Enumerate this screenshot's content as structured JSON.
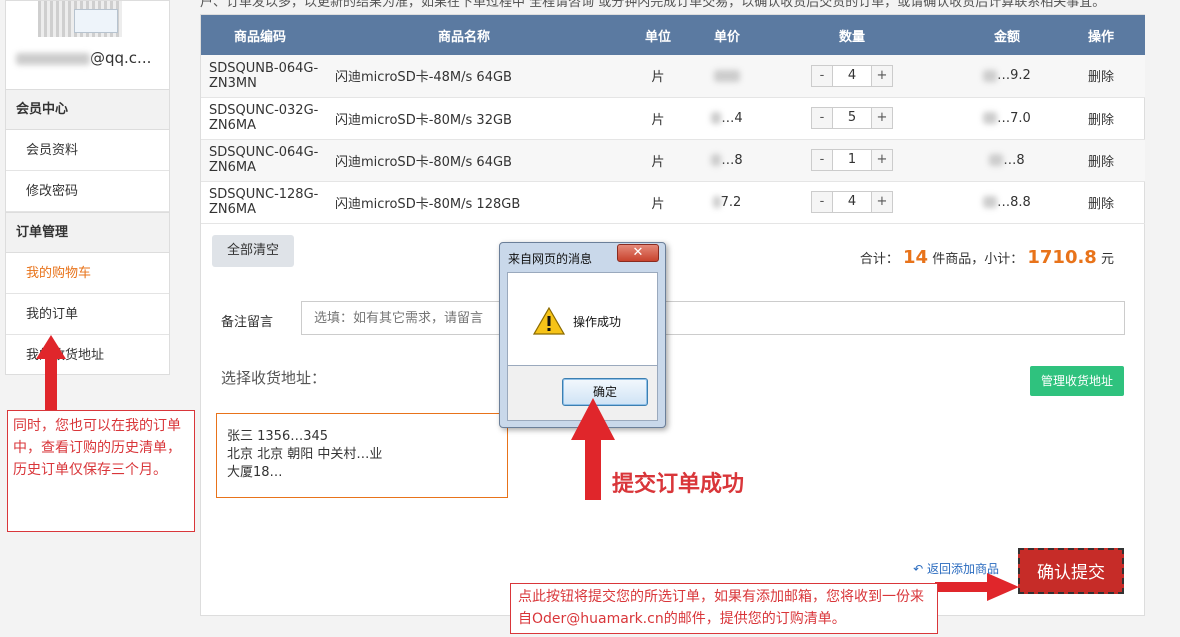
{
  "top_text": "户、订单发以多，以更新的结果为准，如果在下单过程中 全程请咨询 或分钟内完成订单交易，以确认收货后交货的订单，或请确认收货后计算联系相关事宜。",
  "sidebar": {
    "email_suffix": "@qq.c...",
    "section_member": "会员中心",
    "item_profile": "会员资料",
    "item_password": "修改密码",
    "section_orders": "订单管理",
    "item_cart": "我的购物车",
    "item_orders": "我的订单",
    "item_address": "我的收货地址"
  },
  "table": {
    "headers": [
      "商品编码",
      "商品名称",
      "单位",
      "单价",
      "数量",
      "金额",
      "操作"
    ],
    "rows": [
      {
        "code": "SDSQUNB-064G-ZN3MN",
        "name": "闪迪microSD卡-48M/s 64GB",
        "unit": "片",
        "price": "…",
        "qty": "4",
        "amount": "…9.2",
        "action": "删除"
      },
      {
        "code": "SDSQUNC-032G-ZN6MA",
        "name": "闪迪microSD卡-80M/s 32GB",
        "unit": "片",
        "price": "…4",
        "qty": "5",
        "amount": "…7.0",
        "action": "删除"
      },
      {
        "code": "SDSQUNC-064G-ZN6MA",
        "name": "闪迪microSD卡-80M/s 64GB",
        "unit": "片",
        "price": "…8",
        "qty": "1",
        "amount": "…8",
        "action": "删除"
      },
      {
        "code": "SDSQUNC-128G-ZN6MA",
        "name": "闪迪microSD卡-80M/s 128GB",
        "unit": "片",
        "price": "7.2",
        "qty": "4",
        "amount": "…8.8",
        "action": "删除"
      }
    ],
    "qty_minus": "-",
    "qty_plus": "+"
  },
  "clear_all": "全部清空",
  "summary": {
    "prefix": "合计：",
    "count": "14",
    "mid": "件商品，小计：",
    "total": "1710.8",
    "suffix": "元"
  },
  "remark": {
    "label": "备注留言",
    "placeholder": "选填：如有其它需求，请留言"
  },
  "address": {
    "label": "选择收货地址：",
    "manage_button": "管理收货地址",
    "line1": "张三 1356…345",
    "line2": "北京 北京 朝阳 中关村…业",
    "line3": "大厦18…"
  },
  "back_link": "返回添加商品",
  "confirm_button": "确认提交",
  "dialog": {
    "title": "来自网页的消息",
    "close": "✕",
    "message": "操作成功",
    "ok": "确定"
  },
  "annotations": {
    "left_note": "同时，您也可以在我的订单中，查看订购的历史清单，历史订单仅保存三个月。",
    "success_text": "提交订单成功",
    "bottom_note": "点此按钮将提交您的所选订单，如果有添加邮箱，您将收到一份来自Oder@huamark.cn的邮件，提供您的订购清单。"
  },
  "colors": {
    "header_blue": "#5b7aa1",
    "accent_orange": "#e8731a",
    "confirm_red": "#c62c28",
    "manage_green": "#2fc27e",
    "annotation_red": "#d9363a"
  }
}
